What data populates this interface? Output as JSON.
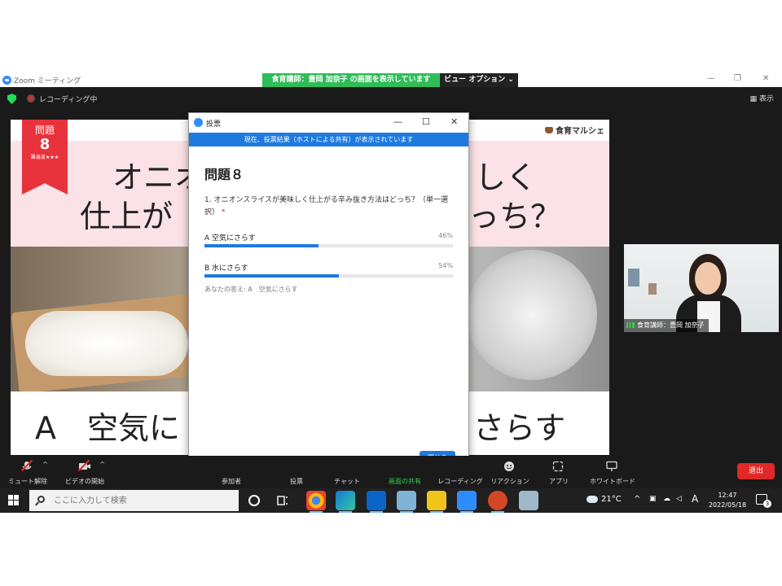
{
  "window": {
    "app_title": "Zoom ミーティング",
    "share_banner": "食育講師：豊岡 加奈子 の画面を表示しています",
    "view_options": "ビュー オプション ⌄"
  },
  "topbar": {
    "recording_label": "レコーディング中",
    "view_label": "表示"
  },
  "slide": {
    "badge_title": "問題",
    "badge_number": "8",
    "badge_level": "難易度★★★",
    "brand": "食育マルシェ",
    "question_left_line1": "オニオ",
    "question_right_line1": "しく",
    "question_left_line2": "仕上が",
    "question_right_line2": "っち？",
    "answer_left": "A　空気に",
    "answer_right": "さらす"
  },
  "participant": {
    "name": "食育講師：豊岡 加奈子"
  },
  "poll": {
    "window_title": "投票",
    "banner": "現在、投票結果（ホストによる共有）が表示されています",
    "question_title": "問題８",
    "question_text": "1. オニオンスライスが美味しく仕上がる辛み抜き方法はどっち？（単一選択）",
    "required_mark": "*",
    "options": [
      {
        "label": "A  空気にさらす",
        "percent_text": "46%",
        "percent": 46
      },
      {
        "label": "B  水にさらす",
        "percent_text": "54%",
        "percent": 54
      }
    ],
    "your_answer": "あなたの答え: A　空気にさらす",
    "close_button": "閉じる"
  },
  "toolbar": {
    "mute": "ミュート解除",
    "video": "ビデオの開始",
    "participants": "参加者",
    "polls": "投票",
    "chat": "チャット",
    "share": "画面の共有",
    "record": "レコーディング",
    "reactions": "リアクション",
    "apps": "アプリ",
    "whiteboard": "ホワイトボード",
    "leave": "退出"
  },
  "taskbar": {
    "search_placeholder": "ここに入力して検索",
    "weather": "21°C",
    "time": "12:47",
    "date": "2022/05/18",
    "ime": "A",
    "notifications": "3"
  },
  "colors": {
    "zoom_blue": "#2d8cff",
    "poll_blue": "#1f7ae0",
    "share_green": "#2fbd59",
    "leave_red": "#e02828",
    "slide_pink": "#fbe2e7",
    "badge_red": "#e8323c"
  }
}
